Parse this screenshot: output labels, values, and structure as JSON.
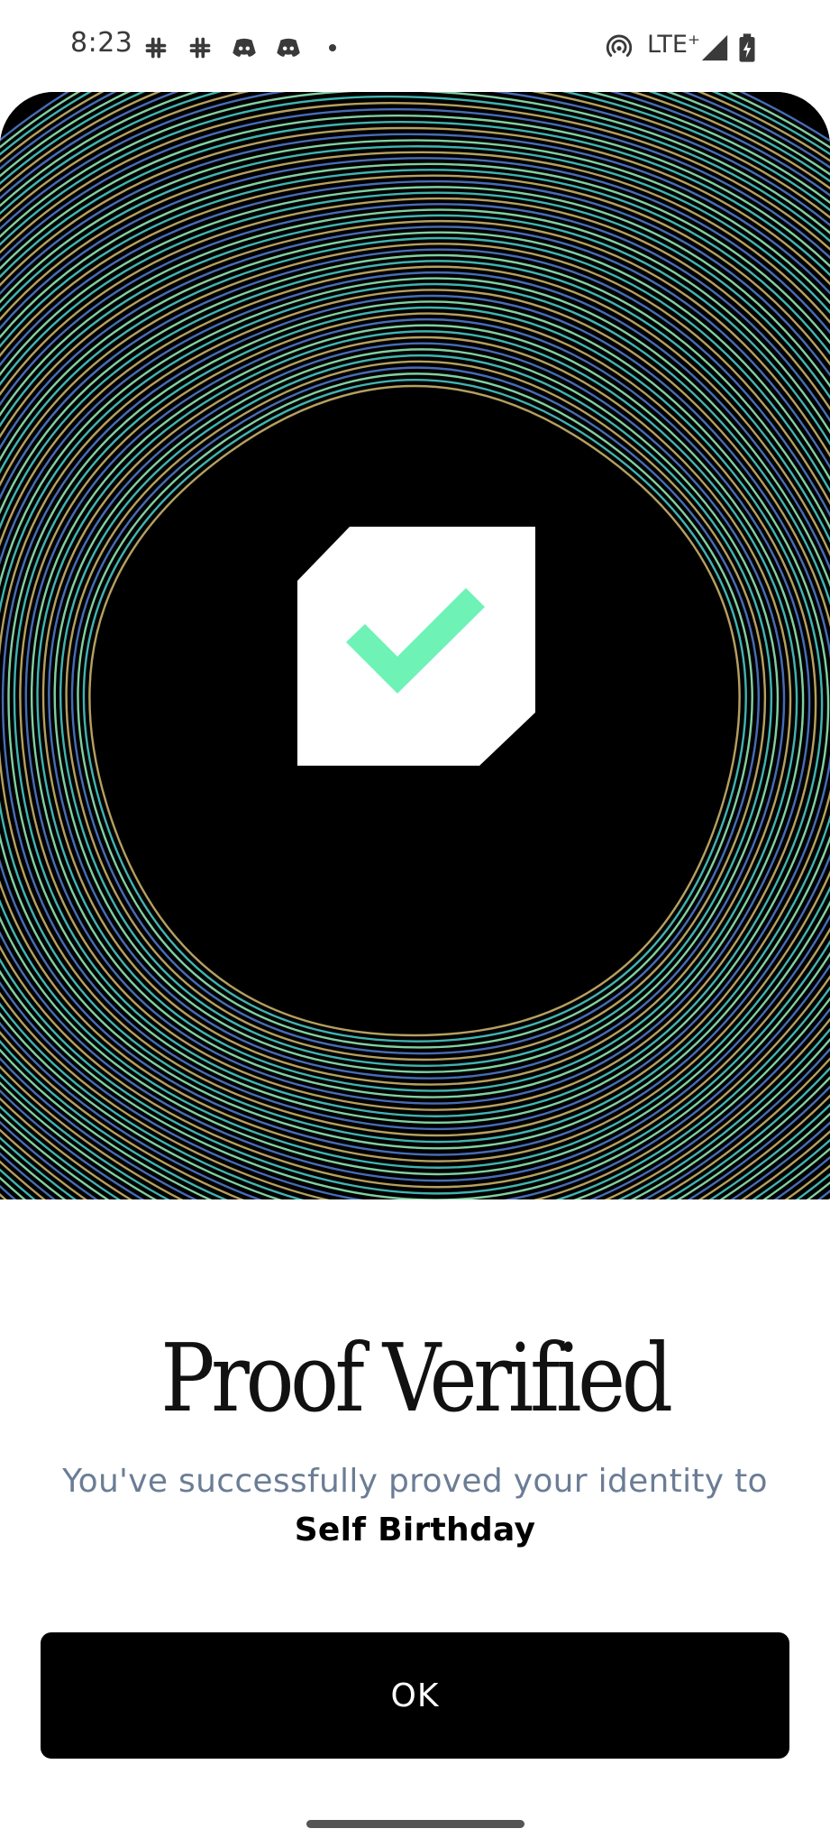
{
  "status_bar": {
    "time": "8:23",
    "network": "LTE⁺",
    "notification_icons": [
      "slack-icon",
      "slack-icon",
      "discord-icon",
      "discord-icon",
      "more-notifications-dot-icon"
    ],
    "system_icons": [
      "hotspot-icon",
      "signal-icon",
      "battery-charging-icon"
    ]
  },
  "hero": {
    "icon": "checkmark-icon",
    "colors": {
      "background": "#000000",
      "check": "#6ef2b6",
      "badge": "#ffffff",
      "line_gold": "#c9b169",
      "line_teal": "#48c7c2",
      "line_blue": "#4f78c8",
      "line_mint": "#8fe6b2"
    }
  },
  "content": {
    "title": "Proof Verified",
    "subtitle_prefix": "You've successfully proved your identity to",
    "app_name": "Self Birthday"
  },
  "actions": {
    "ok_label": "OK"
  },
  "colors": {
    "subtitle": "#6b7d95",
    "button_bg": "#000000",
    "button_text": "#ffffff"
  }
}
